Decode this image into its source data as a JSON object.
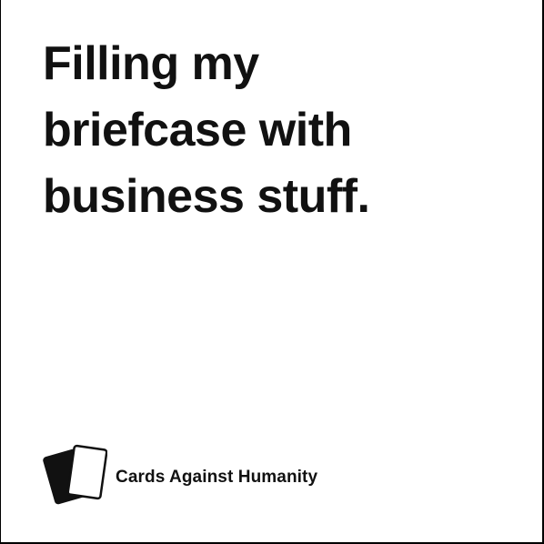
{
  "card": {
    "text": "Filling my\nbriefcase with\nbusiness stuff.",
    "brand_name": "Cards Against Humanity",
    "logo_icon": "two-cards-icon",
    "colors": {
      "background": "#ffffff",
      "text": "#111111",
      "border": "#000000"
    }
  }
}
